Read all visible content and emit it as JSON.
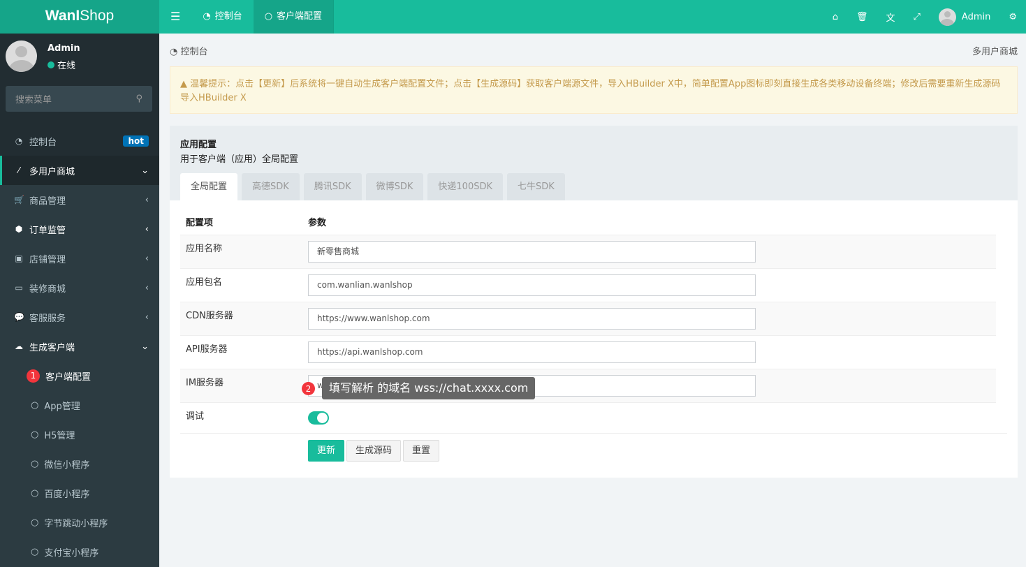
{
  "header": {
    "logo_bold": "WanI",
    "logo_rest": "Shop",
    "nav": [
      {
        "label": "控制台",
        "icon": "dashboard-icon"
      },
      {
        "label": "客户端配置",
        "icon": "circle-icon"
      }
    ],
    "user": "Admin"
  },
  "sidebar": {
    "user": {
      "name": "Admin",
      "status": "在线"
    },
    "search_placeholder": "搜索菜单",
    "items": [
      {
        "label": "控制台",
        "badge": "hot"
      },
      {
        "label": "多用户商城"
      },
      {
        "label": "商品管理"
      },
      {
        "label": "订单监管"
      },
      {
        "label": "店铺管理"
      },
      {
        "label": "装修商城"
      },
      {
        "label": "客服服务"
      },
      {
        "label": "生成客户端"
      }
    ],
    "sub": [
      {
        "label": "客户端配置",
        "marker": "1"
      },
      {
        "label": "App管理"
      },
      {
        "label": "H5管理"
      },
      {
        "label": "微信小程序"
      },
      {
        "label": "百度小程序"
      },
      {
        "label": "字节跳动小程序"
      },
      {
        "label": "支付宝小程序"
      }
    ]
  },
  "breadcrumb": {
    "left": "控制台",
    "right": "多用户商城"
  },
  "warning": "温馨提示：点击【更新】后系统将一键自动生成客户端配置文件；点击【生成源码】获取客户端源文件，导入HBuilder X中，简单配置App图标即刻直接生成各类移动设备终端；修改后需要重新生成源码导入HBuilder X",
  "panel": {
    "title": "应用配置",
    "subtitle": "用于客户端（应用）全局配置",
    "tabs": [
      "全局配置",
      "高德SDK",
      "腾讯SDK",
      "微博SDK",
      "快递100SDK",
      "七牛SDK"
    ],
    "columns": [
      "配置项",
      "参数"
    ],
    "rows": [
      {
        "label": "应用名称",
        "value": "新零售商城"
      },
      {
        "label": "应用包名",
        "value": "com.wanlian.wanlshop"
      },
      {
        "label": "CDN服务器",
        "value": "https://www.wanlshop.com"
      },
      {
        "label": "API服务器",
        "value": "https://api.wanlshop.com"
      },
      {
        "label": "IM服务器",
        "value": "wss://chat.wanlshop.com"
      }
    ],
    "debug_label": "调试",
    "debug_on": true,
    "buttons": {
      "update": "更新",
      "generate": "生成源码",
      "reset": "重置"
    }
  },
  "annotation": {
    "marker": "2",
    "text": "填写解析 的域名 wss://chat.xxxx.com"
  }
}
